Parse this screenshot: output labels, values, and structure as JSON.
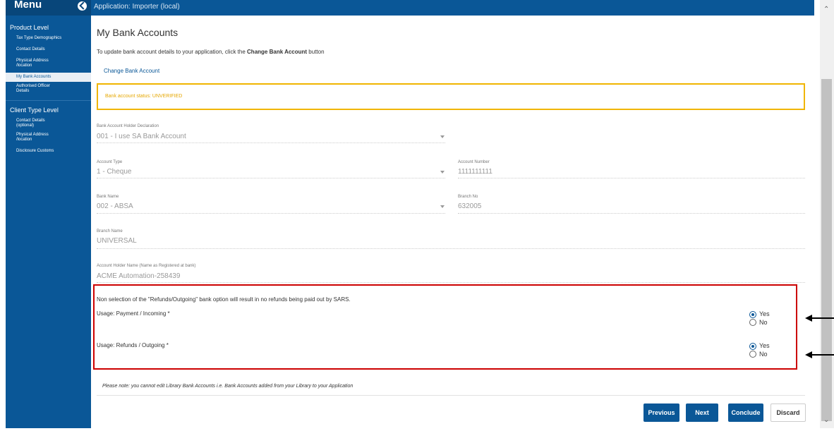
{
  "sidebar": {
    "menu_title": "Menu",
    "section1": "Product Level",
    "items1": [
      "Tax Type Demographics",
      "Contact Details",
      "Physical Address /location",
      "My Bank Accounts",
      "Authorised Officer Details"
    ],
    "section2": "Client Type Level",
    "items2": [
      "Contact Details (optional)",
      "Physical Address /location",
      "Disclosure Customs"
    ]
  },
  "topbar": {
    "text": "Application: Importer (local)"
  },
  "main": {
    "title": "My Bank Accounts",
    "intro_prefix": "To update bank account details to your application, click the ",
    "intro_bold": "Change Bank Account",
    "intro_suffix": " button",
    "change_link": "Change Bank Account",
    "status": "Bank account status: UNVERIFIED",
    "fields": {
      "declaration_label": "Bank Account Holder Declaration",
      "declaration_value": "001 - I use SA Bank Account",
      "account_type_label": "Account Type",
      "account_type_value": "1 - Cheque",
      "account_number_label": "Account Number",
      "account_number_value": "1111111111",
      "bank_name_label": "Bank Name",
      "bank_name_value": "002 - ABSA",
      "branch_no_label": "Branch No",
      "branch_no_value": "632005",
      "branch_name_label": "Branch Name",
      "branch_name_value": "UNIVERSAL",
      "holder_name_label": "Account Holder Name (Name as Registered at bank)",
      "holder_name_value": "ACME Automation-258439"
    },
    "usage": {
      "notice": "Non selection of the \"Refunds/Outgoing\" bank option will result in no refunds being paid out by SARS.",
      "payment_label": "Usage: Payment / Incoming *",
      "refunds_label": "Usage: Refunds / Outgoing *",
      "yes": "Yes",
      "no": "No",
      "payment_selected": "Yes",
      "refunds_selected": "Yes"
    },
    "footer_note": "Please note: you cannot edit Library Bank Accounts i.e. Bank Accounts added from your Library to your Application",
    "buttons": {
      "previous": "Previous",
      "next": "Next",
      "conclude": "Conclude",
      "discard": "Discard"
    }
  }
}
